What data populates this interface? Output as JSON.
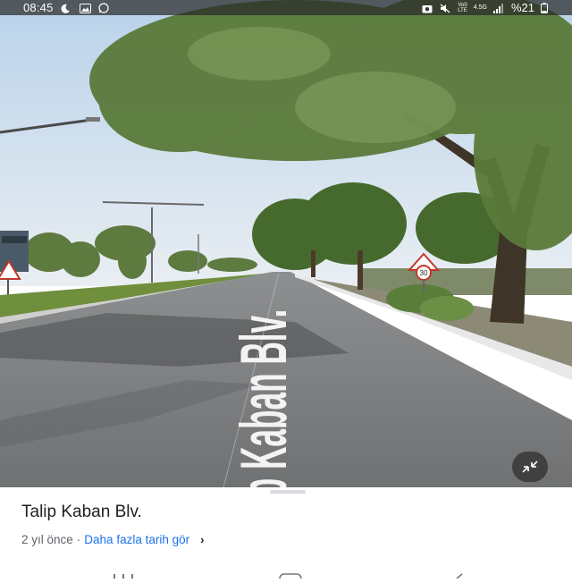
{
  "status_bar": {
    "time": "08:45",
    "network_top": "Vo0",
    "network_bottom": "LTE",
    "network_gen": "4.5G",
    "battery": "%21"
  },
  "street_view": {
    "road_marking": "Talip Kaban Blv.",
    "exit_button_icon": "exit-fullscreen-icon",
    "speed_sign_value": "30"
  },
  "place_card": {
    "title": "Talip Kaban Blv.",
    "age": "2 yıl önce",
    "separator": "·",
    "more_dates_link": "Daha fazla tarih gör",
    "arrow": "›"
  },
  "colors": {
    "link": "#1a73e8",
    "title": "#202124",
    "secondary": "#5f6368"
  }
}
